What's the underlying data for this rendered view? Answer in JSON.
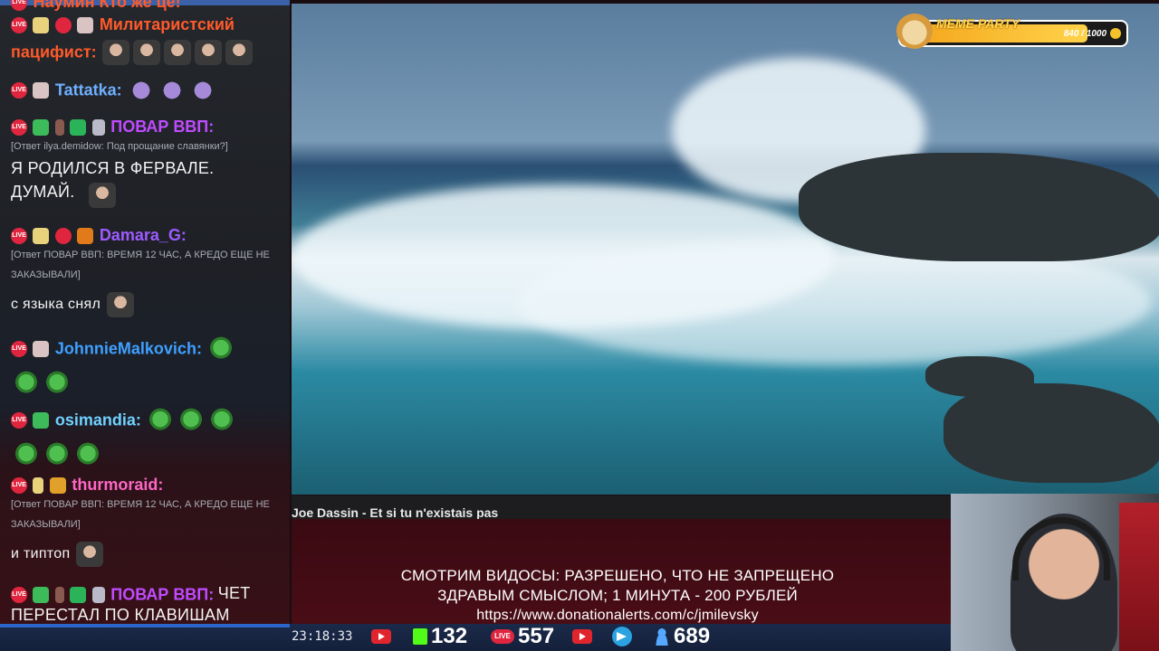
{
  "chat": {
    "messages": [
      {
        "name": "Наумин Кто же це!",
        "text": ""
      },
      {
        "name": "Милитаристский",
        "text": "пацифист:"
      },
      {
        "name": "Tattatka:",
        "text": ""
      },
      {
        "name": "ПОВАР ВВП:",
        "reply": "[Ответ ilya.demidow: Под прощание славянки?]",
        "text": "Я РОДИЛСЯ В ФЕРВАЛЕ. ДУМАЙ."
      },
      {
        "name": "Damara_G:",
        "reply": "[Ответ ПОВАР ВВП: ВРЕМЯ 12 ЧАС, А КРЕДО ЕЩЕ НЕ ЗАКАЗЫВАЛИ]",
        "text": "с языка снял"
      },
      {
        "name": "JohnnieMalkovich:",
        "text": ""
      },
      {
        "name": "osimandia:",
        "text": ""
      },
      {
        "name": "thurmoraid:",
        "reply": "[Ответ ПОВАР ВВП: ВРЕМЯ 12 ЧАС, А КРЕДО ЕЩЕ НЕ ЗАКАЗЫВАЛИ]",
        "text": "и типтоп"
      },
      {
        "name": "ПОВАР ВВП:",
        "text": "ЧЕТ ПЕРЕСТАЛ ПО КЛАВИШАМ ПОПАДАТЬ"
      }
    ],
    "name_colors": {
      "militarist": "#ff5a2a",
      "tattatka": "#6fb0ff",
      "povar": "#c04bff",
      "damara": "#9d5bff",
      "johnnie": "#3fa0ff",
      "osimandia": "#6fd2ff",
      "thurmoraid": "#ff66c4"
    }
  },
  "video": {
    "title": "Joe Dassin - Et si tu n'existais pas"
  },
  "meme_party": {
    "label": "MEME PARTY",
    "progress": "840 / 1000",
    "progress_fraction": 0.84
  },
  "donation": {
    "line1": "СМОТРИМ ВИДОСЫ: РАЗРЕШЕНО, ЧТО НЕ ЗАПРЕЩЕНО",
    "line2": "ЗДРАВЫМ СМЫСЛОМ; 1 МИНУТА - 200 РУБЛЕЙ",
    "url": "https://www.donationalerts.com/c/jmilevsky"
  },
  "status": {
    "clock": "23:18:33",
    "kick_viewers": "132",
    "vk_viewers": "557",
    "total_viewers": "689"
  },
  "icons": {
    "youtube": "youtube-icon",
    "kick": "kick-icon",
    "vk": "vk-live-icon",
    "telegram": "telegram-icon",
    "viewers": "user-icon",
    "coin": "coin-icon"
  }
}
